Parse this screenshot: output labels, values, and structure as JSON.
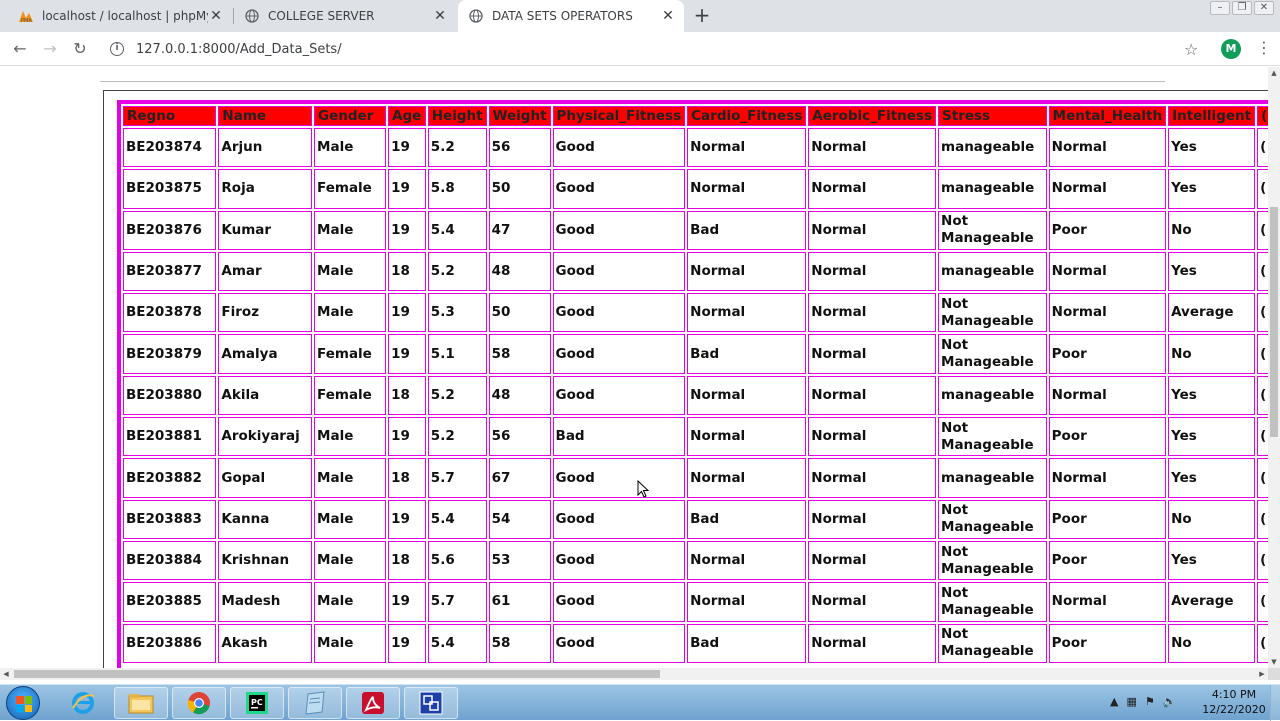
{
  "browser": {
    "tabs": [
      {
        "title": "localhost / localhost | phpMyAdmin",
        "icon": "phpmyadmin-icon"
      },
      {
        "title": "COLLEGE SERVER",
        "icon": "globe-icon"
      },
      {
        "title": "DATA SETS OPERATORS",
        "icon": "globe-icon"
      }
    ],
    "active_tab": 2,
    "url": "127.0.0.1:8000/Add_Data_Sets/",
    "profile_initial": "M"
  },
  "table": {
    "headers": [
      "Regno",
      "Name",
      "Gender",
      "Age",
      "Height",
      "Weight",
      "Physical_Fitness",
      "Cardio_Fitness",
      "Aerobic_Fitness",
      "Stress",
      "Mental_Health",
      "Intelligent",
      "("
    ],
    "rows": [
      [
        "BE203874",
        "Arjun",
        "Male",
        "19",
        "5.2",
        "56",
        "Good",
        "Normal",
        "Normal",
        "manageable",
        "Normal",
        "Yes",
        "("
      ],
      [
        "BE203875",
        "Roja",
        "Female",
        "19",
        "5.8",
        "50",
        "Good",
        "Normal",
        "Normal",
        "manageable",
        "Normal",
        "Yes",
        "("
      ],
      [
        "BE203876",
        "Kumar",
        "Male",
        "19",
        "5.4",
        "47",
        "Good",
        "Bad",
        "Normal",
        "Not Manageable",
        "Poor",
        "No",
        "("
      ],
      [
        "BE203877",
        "Amar",
        "Male",
        "18",
        "5.2",
        "48",
        "Good",
        "Normal",
        "Normal",
        "manageable",
        "Normal",
        "Yes",
        "("
      ],
      [
        "BE203878",
        "Firoz",
        "Male",
        "19",
        "5.3",
        "50",
        "Good",
        "Normal",
        "Normal",
        "Not Manageable",
        "Normal",
        "Average",
        "("
      ],
      [
        "BE203879",
        "Amalya",
        "Female",
        "19",
        "5.1",
        "58",
        "Good",
        "Bad",
        "Normal",
        "Not Manageable",
        "Poor",
        "No",
        "("
      ],
      [
        "BE203880",
        "Akila",
        "Female",
        "18",
        "5.2",
        "48",
        "Good",
        "Normal",
        "Normal",
        "manageable",
        "Normal",
        "Yes",
        "("
      ],
      [
        "BE203881",
        "Arokiyaraj",
        "Male",
        "19",
        "5.2",
        "56",
        "Bad",
        "Normal",
        "Normal",
        "Not Manageable",
        "Poor",
        "Yes",
        "("
      ],
      [
        "BE203882",
        "Gopal",
        "Male",
        "18",
        "5.7",
        "67",
        "Good",
        "Normal",
        "Normal",
        "manageable",
        "Normal",
        "Yes",
        "("
      ],
      [
        "BE203883",
        "Kanna",
        "Male",
        "19",
        "5.4",
        "54",
        "Good",
        "Bad",
        "Normal",
        "Not Manageable",
        "Poor",
        "No",
        "("
      ],
      [
        "BE203884",
        "Krishnan",
        "Male",
        "18",
        "5.6",
        "53",
        "Good",
        "Normal",
        "Normal",
        "Not Manageable",
        "Poor",
        "Yes",
        "("
      ],
      [
        "BE203885",
        "Madesh",
        "Male",
        "19",
        "5.7",
        "61",
        "Good",
        "Normal",
        "Normal",
        "Not Manageable",
        "Normal",
        "Average",
        "("
      ],
      [
        "BE203886",
        "Akash",
        "Male",
        "19",
        "5.4",
        "58",
        "Good",
        "Bad",
        "Normal",
        "Not Manageable",
        "Poor",
        "No",
        "("
      ]
    ],
    "border_color": "#e600e6",
    "header_color": "#ff0000"
  },
  "taskbar": {
    "apps": [
      "start-button",
      "internet-explorer-icon",
      "file-explorer-icon",
      "chrome-icon",
      "pycharm-icon",
      "notepad-icon",
      "acrobat-icon",
      "remote-app-icon"
    ],
    "time": "4:10 PM",
    "date": "12/22/2020"
  }
}
